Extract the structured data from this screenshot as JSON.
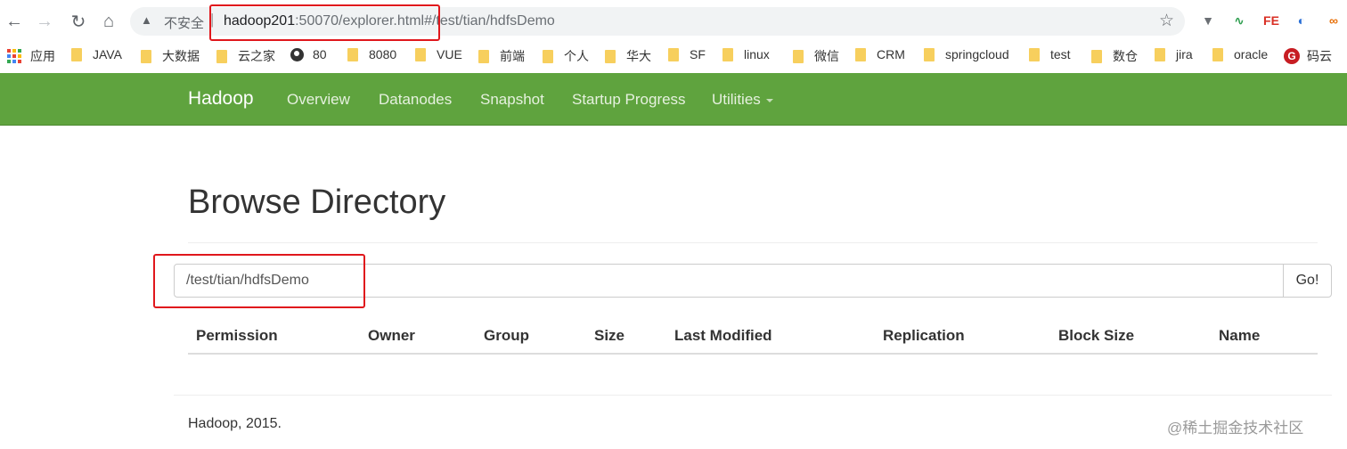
{
  "browser": {
    "security_label": "不安全",
    "url_separator": "|",
    "url_host": "hadoop201",
    "url_rest": ":50070/explorer.html#/test/tian/hdfsDemo",
    "extensions": [
      {
        "name": "funnel",
        "glyph": "▼",
        "color": "#6b6f74"
      },
      {
        "name": "check",
        "glyph": "∿",
        "color": "#2e9e4f"
      },
      {
        "name": "fe",
        "glyph": "FE",
        "color": "#d93025"
      },
      {
        "name": "circle",
        "glyph": "◐",
        "color": "#2a6fd6"
      },
      {
        "name": "infinity",
        "glyph": "∞",
        "color": "#e8710a"
      }
    ]
  },
  "bookmarks": {
    "apps_label": "应用",
    "items": [
      {
        "label": "JAVA",
        "type": "folder"
      },
      {
        "label": "大数据",
        "type": "folder"
      },
      {
        "label": "云之家",
        "type": "folder"
      },
      {
        "label": "80",
        "type": "globe"
      },
      {
        "label": "8080",
        "type": "folder"
      },
      {
        "label": "VUE",
        "type": "folder"
      },
      {
        "label": "前端",
        "type": "folder"
      },
      {
        "label": "个人",
        "type": "folder"
      },
      {
        "label": "华大",
        "type": "folder"
      },
      {
        "label": "SF",
        "type": "folder"
      },
      {
        "label": "linux",
        "type": "folder"
      },
      {
        "label": "微信",
        "type": "folder"
      },
      {
        "label": "CRM",
        "type": "folder"
      },
      {
        "label": "springcloud",
        "type": "folder"
      },
      {
        "label": "test",
        "type": "folder"
      },
      {
        "label": "数仓",
        "type": "folder"
      },
      {
        "label": "jira",
        "type": "folder"
      },
      {
        "label": "oracle",
        "type": "folder"
      },
      {
        "label": "码云",
        "type": "gitee"
      }
    ]
  },
  "navbar": {
    "brand": "Hadoop",
    "links": [
      "Overview",
      "Datanodes",
      "Snapshot",
      "Startup Progress",
      "Utilities"
    ],
    "background": "#5fa33e"
  },
  "main": {
    "title": "Browse Directory",
    "path_value": "/test/tian/hdfsDemo",
    "go_label": "Go!",
    "columns": [
      "Permission",
      "Owner",
      "Group",
      "Size",
      "Last Modified",
      "Replication",
      "Block Size",
      "Name"
    ]
  },
  "footer": {
    "text": "Hadoop, 2015.",
    "watermark": "@稀土掘金技术社区"
  }
}
